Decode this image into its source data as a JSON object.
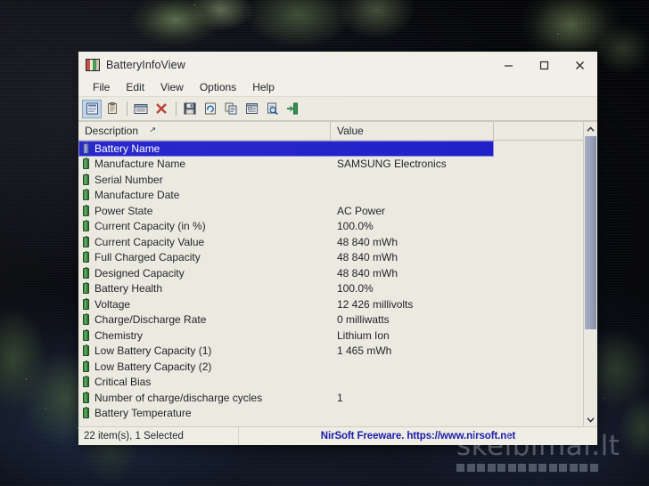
{
  "window": {
    "title": "BatteryInfoView",
    "icon": "battery-app-icon",
    "controls": {
      "minimize": "minimize-icon",
      "maximize": "maximize-icon",
      "close": "close-icon"
    }
  },
  "menu": {
    "items": [
      {
        "label": "File"
      },
      {
        "label": "Edit"
      },
      {
        "label": "View"
      },
      {
        "label": "Options"
      },
      {
        "label": "Help"
      }
    ]
  },
  "toolbar": {
    "buttons": [
      {
        "name": "properties-icon",
        "active": true
      },
      {
        "name": "clipboard-icon",
        "active": false
      },
      {
        "name": "report-icon",
        "active": false
      },
      {
        "name": "delete-icon",
        "active": false
      },
      {
        "name": "save-icon",
        "active": false
      },
      {
        "name": "refresh-icon",
        "active": false
      },
      {
        "name": "copy-icon",
        "active": false
      },
      {
        "name": "html-report-icon",
        "active": false
      },
      {
        "name": "find-icon",
        "active": false
      },
      {
        "name": "exit-icon",
        "active": false
      }
    ]
  },
  "list": {
    "columns": [
      {
        "key": "description",
        "label": "Description",
        "sorted": true,
        "sort_glyph": "↗"
      },
      {
        "key": "value",
        "label": "Value",
        "sorted": false
      }
    ],
    "rows": [
      {
        "description": "Battery Name",
        "value": "",
        "selected": true
      },
      {
        "description": "Manufacture Name",
        "value": "SAMSUNG Electronics",
        "selected": false
      },
      {
        "description": "Serial Number",
        "value": "",
        "selected": false
      },
      {
        "description": "Manufacture Date",
        "value": "",
        "selected": false
      },
      {
        "description": "Power State",
        "value": "AC Power",
        "selected": false
      },
      {
        "description": "Current Capacity (in %)",
        "value": "100.0%",
        "selected": false
      },
      {
        "description": "Current Capacity Value",
        "value": "48 840 mWh",
        "selected": false
      },
      {
        "description": "Full Charged Capacity",
        "value": "48 840 mWh",
        "selected": false
      },
      {
        "description": "Designed Capacity",
        "value": "48 840 mWh",
        "selected": false
      },
      {
        "description": "Battery Health",
        "value": "100.0%",
        "selected": false
      },
      {
        "description": "Voltage",
        "value": "12 426 millivolts",
        "selected": false
      },
      {
        "description": "Charge/Discharge Rate",
        "value": "0 milliwatts",
        "selected": false
      },
      {
        "description": "Chemistry",
        "value": "Lithium Ion",
        "selected": false
      },
      {
        "description": "Low Battery Capacity (1)",
        "value": "1 465 mWh",
        "selected": false
      },
      {
        "description": "Low Battery Capacity (2)",
        "value": "",
        "selected": false
      },
      {
        "description": "Critical Bias",
        "value": "",
        "selected": false
      },
      {
        "description": "Number of charge/discharge cycles",
        "value": "1",
        "selected": false
      },
      {
        "description": "Battery Temperature",
        "value": "",
        "selected": false
      }
    ],
    "scrollbar": {
      "up_arrow": "chevron-up-icon",
      "down_arrow": "chevron-down-icon"
    }
  },
  "status": {
    "items_text": "22 item(s), 1 Selected",
    "link_text": "NirSoft Freeware. https://www.nirsoft.net",
    "link_color": "#1a1ab4"
  },
  "watermark": {
    "text": "skelbimai.lt",
    "square_count": 14
  }
}
